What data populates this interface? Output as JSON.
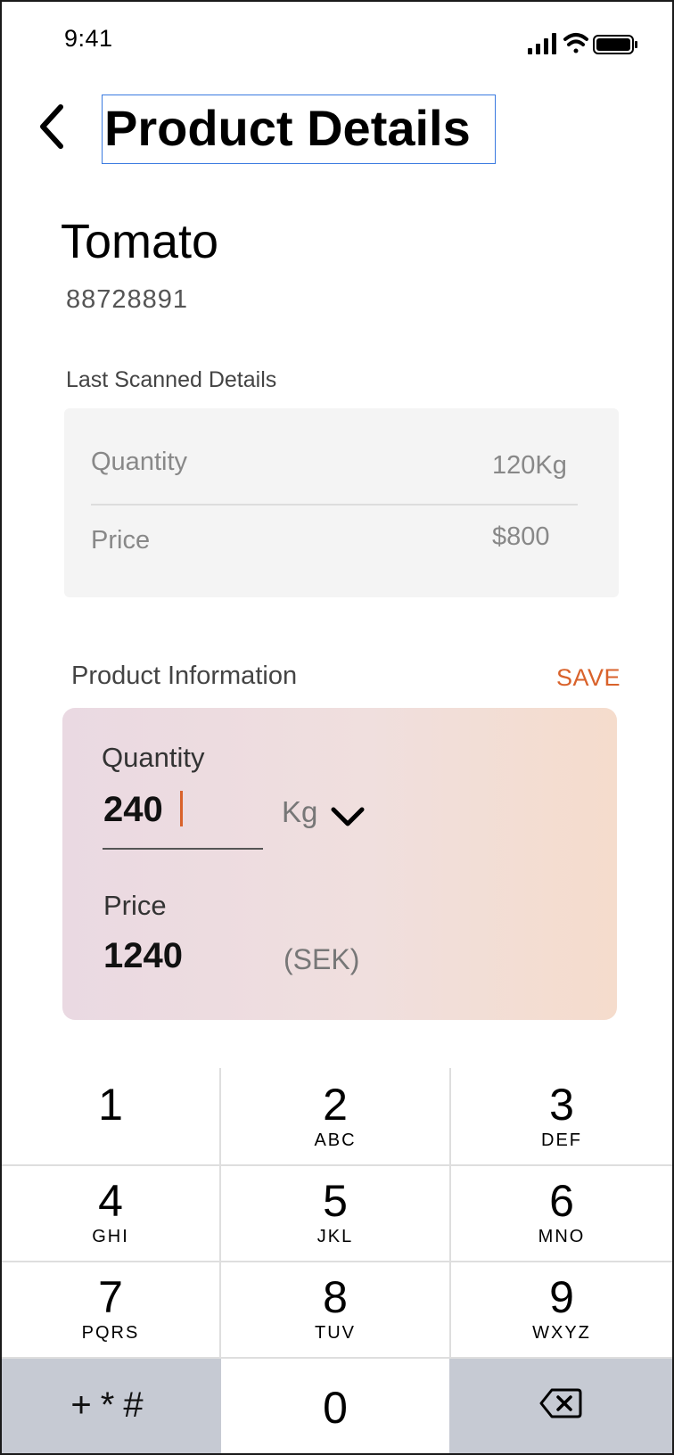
{
  "status_bar": {
    "time": "9:41"
  },
  "header": {
    "title": "Product Details"
  },
  "product": {
    "name": "Tomato",
    "code": "88728891"
  },
  "last_scanned": {
    "section_label": "Last Scanned Details",
    "quantity_label": "Quantity",
    "quantity_value": "120Kg",
    "price_label": "Price",
    "price_value": "$800"
  },
  "product_information": {
    "section_label": "Product Information",
    "save_label": "SAVE",
    "quantity_label": "Quantity",
    "quantity_value": "240",
    "unit": "Kg",
    "price_label": "Price",
    "price_value": "1240",
    "currency": "(SEK)"
  },
  "keypad": {
    "keys": [
      {
        "num": "1",
        "letters": ""
      },
      {
        "num": "2",
        "letters": "ABC"
      },
      {
        "num": "3",
        "letters": "DEF"
      },
      {
        "num": "4",
        "letters": "GHI"
      },
      {
        "num": "5",
        "letters": "JKL"
      },
      {
        "num": "6",
        "letters": "MNO"
      },
      {
        "num": "7",
        "letters": "PQRS"
      },
      {
        "num": "8",
        "letters": "TUV"
      },
      {
        "num": "9",
        "letters": "WXYZ"
      }
    ],
    "symbols": "+*#",
    "zero": "0"
  },
  "colors": {
    "accent": "#d9622b",
    "focus_outline": "#3a7ae0",
    "keypad_dark": "#c6cad3"
  }
}
